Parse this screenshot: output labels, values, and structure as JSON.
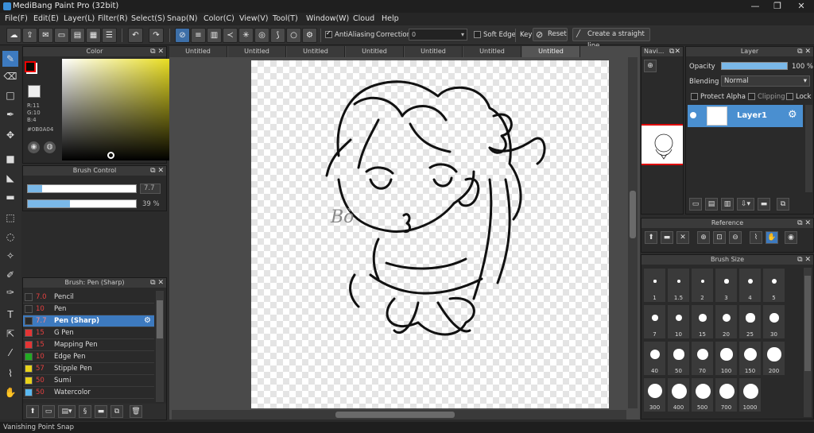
{
  "app": {
    "title": "MediBang Paint Pro (32bit)"
  },
  "menu": [
    "File(F)",
    "Edit(E)",
    "Layer(L)",
    "Filter(R)",
    "Select(S)",
    "Snap(N)",
    "Color(C)",
    "View(V)",
    "Tool(T)",
    "Window(W)",
    "Cloud",
    "Help"
  ],
  "toolbar": {
    "antialiasing_label": "AntiAliasing",
    "antialiasing_checked": true,
    "correction_label": "Correction",
    "correction_value": "0",
    "soft_edge_label": "Soft Edge",
    "key_label": "Key",
    "reset_label": "Reset",
    "straight_line_label": "Create a straight line"
  },
  "tabs": [
    "Untitled",
    "Untitled",
    "Untitled",
    "Untitled",
    "Untitled",
    "Untitled",
    "Untitled"
  ],
  "color_panel": {
    "title": "Color",
    "r": "R:11",
    "g": "G:10",
    "b": "B:4",
    "hex": "#0B0A04",
    "fg_color": "#0b0a04",
    "bg_color": "#ffffff"
  },
  "brush_control": {
    "title": "Brush Control",
    "size_value": "7.7",
    "opacity_value": "39 %",
    "size_fraction": 0.13,
    "opacity_fraction": 0.39
  },
  "brush_list": {
    "title": "Brush: Pen (Sharp)",
    "items": [
      {
        "size": "7.0",
        "name": "Pencil",
        "color": "#2a2a2a"
      },
      {
        "size": "10",
        "name": "Pen",
        "color": "#2a2a2a"
      },
      {
        "size": "7.7",
        "name": "Pen (Sharp)",
        "color": "#2a2a2a",
        "selected": true
      },
      {
        "size": "15",
        "name": "G Pen",
        "color": "#e43535"
      },
      {
        "size": "15",
        "name": "Mapping Pen",
        "color": "#e43535"
      },
      {
        "size": "10",
        "name": "Edge Pen",
        "color": "#22aa22"
      },
      {
        "size": "57",
        "name": "Stipple Pen",
        "color": "#e8d21a"
      },
      {
        "size": "50",
        "name": "Sumi",
        "color": "#e8d21a"
      },
      {
        "size": "50",
        "name": "Watercolor",
        "color": "#5ab8f0"
      }
    ]
  },
  "navigator": {
    "title": "Navi..."
  },
  "layer_panel": {
    "title": "Layer",
    "opacity_label": "Opacity",
    "opacity_value": "100 %",
    "opacity_fraction": 1.0,
    "blending_label": "Blending",
    "blending_value": "Normal",
    "protect_alpha_label": "Protect Alpha",
    "clipping_label": "Clipping",
    "lock_label": "Lock",
    "layer_name": "Layer1"
  },
  "reference_panel": {
    "title": "Reference"
  },
  "brush_size_panel": {
    "title": "Brush Size",
    "sizes": [
      "1",
      "1.5",
      "2",
      "3",
      "4",
      "5",
      "7",
      "10",
      "15",
      "20",
      "25",
      "30",
      "40",
      "50",
      "70",
      "100",
      "150",
      "200",
      "300",
      "400",
      "500",
      "700",
      "1000"
    ]
  },
  "canvas_signature": "Bò",
  "status": {
    "text": "Vanishing Point Snap"
  }
}
